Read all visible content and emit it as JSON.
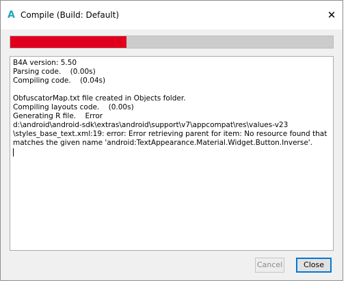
{
  "window": {
    "app_icon_letter": "A",
    "title": "Compile (Build: Default)",
    "close_glyph": "✕"
  },
  "progress": {
    "value_percent": 36,
    "color": "#e0001e",
    "track_color": "#cccccc"
  },
  "log": {
    "lines": [
      "B4A version: 5.50",
      "Parsing code.    (0.00s)",
      "Compiling code.    (0.04s)",
      "",
      "ObfuscatorMap.txt file created in Objects folder.",
      "Compiling layouts code.    (0.00s)",
      "Generating R file.    Error",
      "d:\\android\\android-sdk\\extras\\android\\support\\v7\\appcompat\\res\\values-v23",
      "\\styles_base_text.xml:19: error: Error retrieving parent for item: No resource found that",
      "matches the given name 'android:TextAppearance.Material.Widget.Button.Inverse'."
    ]
  },
  "buttons": {
    "cancel_label": "Cancel",
    "close_label": "Close"
  }
}
